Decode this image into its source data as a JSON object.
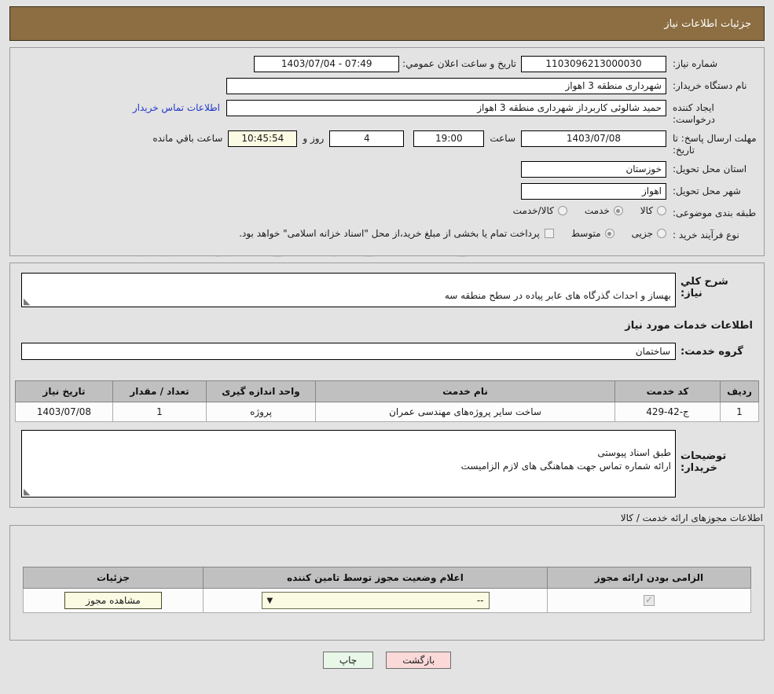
{
  "header": {
    "title": "جزئیات اطلاعات نیاز"
  },
  "top": {
    "need_number_label": "شماره نیاز:",
    "need_number": "1103096213000030",
    "buyer_org_label": "نام دستگاه خریدار:",
    "buyer_org": "شهرداری منطقه 3 اهواز",
    "creator_label": "ایجاد کننده درخواست:",
    "creator": "حمید شالوئی کاربرداز شهرداری منطقه 3 اهواز",
    "contact_link": "اطلاعات تماس خریدار",
    "deadline_label": "مهلت ارسال پاسخ: تا تاریخ:",
    "deadline_date": "1403/07/08",
    "hour_label": "ساعت",
    "deadline_time": "19:00",
    "days_left": "4",
    "days_label": "روز و",
    "countdown": "10:45:54",
    "remaining_label": "ساعت باقي مانده",
    "announce_label": "تاریخ و ساعت اعلان عمومي:",
    "announce_value": "1403/07/04 - 07:49",
    "province_label": "استان محل تحویل:",
    "province": "خوزستان",
    "city_label": "شهر محل تحویل:",
    "city": "اهواز",
    "category_label": "طبقه بندی موضوعی:",
    "category_options": [
      {
        "label": "کالا",
        "selected": false
      },
      {
        "label": "خدمت",
        "selected": true
      },
      {
        "label": "کالا/خدمت",
        "selected": false
      }
    ],
    "process_label": "نوع فرآیند خرید :",
    "process_options": [
      {
        "label": "جزیی",
        "selected": false
      },
      {
        "label": "متوسط",
        "selected": true
      }
    ],
    "treasury_checkbox_label": "پرداخت تمام یا بخشی از مبلغ خرید،از محل \"اسناد خزانه اسلامی\" خواهد بود."
  },
  "mid": {
    "need_desc_label": "شرح کلي نیاز:",
    "need_desc": "بهساز و احداث گذرگاه های عابر پیاده در سطح منطقه سه",
    "services_section_title": "اطلاعات خدمات مورد نیاز",
    "service_group_label": "گروه خدمت:",
    "service_group": "ساختمان",
    "buyer_notes_label": "توضیحات خریدار:",
    "buyer_notes": "طبق اسناد پیوستی\nارائه شماره تماس جهت هماهنگی های لازم الزامیست"
  },
  "services_table": {
    "columns": [
      "ردیف",
      "کد خدمت",
      "نام خدمت",
      "واحد اندازه گیری",
      "تعداد / مقدار",
      "تاریخ نیاز"
    ],
    "rows": [
      {
        "row": "1",
        "code": "ج-42-429",
        "name": "ساخت سایر پروژه‌های مهندسی عمران",
        "unit": "پروژه",
        "qty": "1",
        "date": "1403/07/08"
      }
    ]
  },
  "permits": {
    "section_title": "اطلاعات مجوزهای ارائه خدمت / کالا",
    "columns": [
      "الزامی بودن ارائه مجوز",
      "اعلام وضعیت مجوز توسط تامین کننده",
      "جزئیات"
    ],
    "rows": [
      {
        "required": true,
        "status_value": "--",
        "details_button": "مشاهده مجوز"
      }
    ]
  },
  "footer": {
    "print_label": "چاپ",
    "back_label": "بازگشت"
  },
  "watermark": {
    "text": "AriaTender.net"
  },
  "colors": {
    "header_bg": "#8c6e42",
    "page_bg": "#e3e3e3",
    "link": "#2037c8",
    "countdown_bg": "#fbfbe4",
    "print_bg": "#e9f7e9",
    "back_bg": "#fbd9d9"
  }
}
